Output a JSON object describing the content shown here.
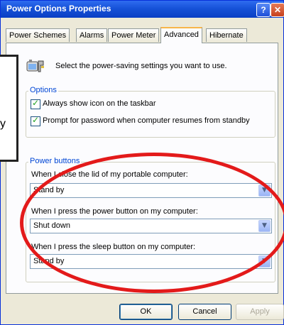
{
  "window": {
    "title": "Power Options Properties",
    "help_glyph": "?",
    "close_glyph": "✕"
  },
  "tabs": [
    {
      "label": "Power Schemes"
    },
    {
      "label": "Alarms"
    },
    {
      "label": "Power Meter"
    },
    {
      "label": "Advanced",
      "active": true
    },
    {
      "label": "Hibernate"
    }
  ],
  "intro": {
    "text": "Select the power-saving settings you want to use.",
    "icon": "battery-power-icon"
  },
  "options": {
    "label": "Options",
    "show_icon": {
      "label": "Always show icon on the taskbar",
      "checked": true
    },
    "prompt_password": {
      "label": "Prompt for password when computer resumes from standby",
      "checked": true
    }
  },
  "power_buttons": {
    "label": "Power buttons",
    "lid": {
      "label": "When I close the lid of my portable computer:",
      "value": "Stand by"
    },
    "power": {
      "label": "When I press the power button on my computer:",
      "value": "Shut down"
    },
    "sleep": {
      "label": "When I press the sleep button on my computer:",
      "value": "Stand by"
    }
  },
  "buttons": {
    "ok": "OK",
    "cancel": "Cancel",
    "apply": "Apply"
  },
  "annotation": {
    "callout_text": "y",
    "highlight_color": "#e31a1a"
  }
}
